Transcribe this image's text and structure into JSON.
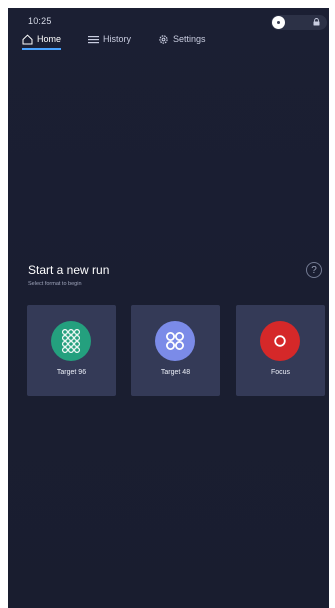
{
  "status_bar": {
    "time": "10:25"
  },
  "nav": {
    "tabs": [
      {
        "id": "home",
        "label": "Home",
        "active": true
      },
      {
        "id": "history",
        "label": "History",
        "active": false
      },
      {
        "id": "settings",
        "label": "Settings",
        "active": false
      }
    ]
  },
  "main": {
    "title": "Start a new run",
    "subtitle": "Select format to begin",
    "help_icon": "question-circle-icon",
    "formats": [
      {
        "label": "Target 96",
        "icon": "grid-96-icon",
        "color": "#24a07e"
      },
      {
        "label": "Target 48",
        "icon": "grid-48-icon",
        "color": "#7b8be8"
      },
      {
        "label": "Focus",
        "icon": "focus-icon",
        "color": "#d52829"
      }
    ]
  },
  "colors": {
    "background": "#1b1f33",
    "card": "#343a57",
    "accent": "#4aa3ff"
  }
}
